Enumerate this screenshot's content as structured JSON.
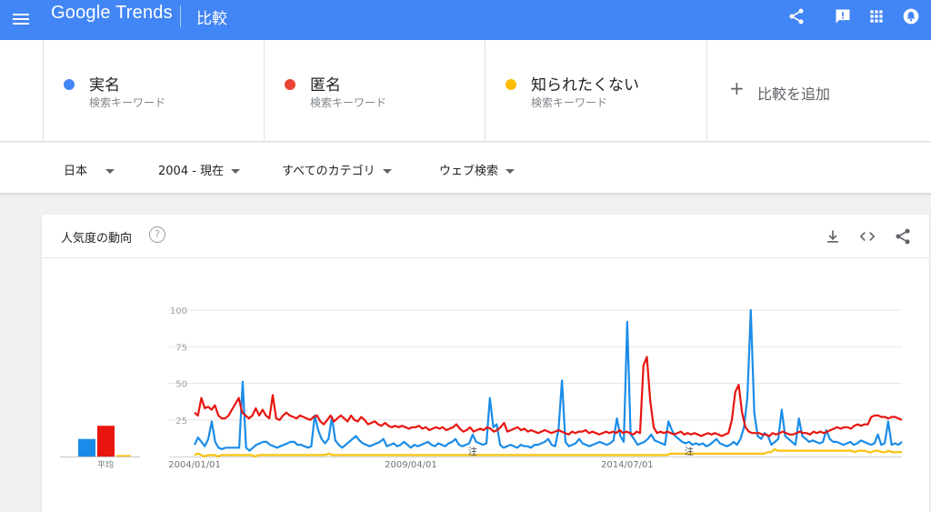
{
  "header": {
    "logo": "Google Trends",
    "page_title": "比較"
  },
  "terms": [
    {
      "name": "実名",
      "subtitle": "検索キーワード",
      "color": "#4285f4"
    },
    {
      "name": "匿名",
      "subtitle": "検索キーワード",
      "color": "#ea4335"
    },
    {
      "name": "知られたくない",
      "subtitle": "検索キーワード",
      "color": "#fbbc04"
    }
  ],
  "add_term_label": "比較を追加",
  "filters": {
    "region": "日本",
    "period": "2004 - 現在",
    "category": "すべてのカテゴリ",
    "search_type": "ウェブ検索"
  },
  "card": {
    "title": "人気度の動向",
    "help": "?"
  },
  "chart_data": {
    "type": "line",
    "x_labels": [
      "2004/01/01",
      "2009/04/01",
      "2014/07/01"
    ],
    "y_ticks": [
      100,
      75,
      50,
      25
    ],
    "ylim": [
      0,
      100
    ],
    "annotation_label": "注",
    "annotations": [
      "2010-10",
      "2016-01"
    ],
    "average": {
      "label": "平均",
      "values": [
        12,
        21,
        1
      ]
    },
    "series": [
      {
        "color": "#1a8ce8",
        "values": [
          8,
          13,
          10,
          7,
          12,
          24,
          10,
          6,
          5,
          6,
          6,
          6,
          6,
          6,
          51,
          6,
          4,
          6,
          8,
          9,
          10,
          10,
          8,
          7,
          6,
          7,
          8,
          9,
          10,
          10,
          8,
          8,
          7,
          6,
          7,
          28,
          18,
          12,
          9,
          12,
          27,
          11,
          8,
          6,
          8,
          10,
          12,
          14,
          11,
          9,
          8,
          7,
          8,
          9,
          10,
          12,
          7,
          8,
          9,
          7,
          8,
          10,
          8,
          6,
          8,
          7,
          8,
          9,
          10,
          8,
          7,
          9,
          8,
          7,
          9,
          10,
          12,
          8,
          7,
          8,
          9,
          15,
          10,
          9,
          8,
          9,
          40,
          20,
          22,
          8,
          6,
          7,
          8,
          7,
          6,
          8,
          7,
          7,
          6,
          8,
          8,
          9,
          10,
          12,
          8,
          7,
          18,
          52,
          10,
          7,
          8,
          9,
          12,
          9,
          8,
          7,
          8,
          9,
          10,
          9,
          8,
          9,
          11,
          26,
          14,
          10,
          92,
          15,
          12,
          8,
          9,
          10,
          12,
          15,
          11,
          10,
          9,
          8,
          24,
          18,
          14,
          12,
          10,
          9,
          10,
          8,
          9,
          8,
          9,
          7,
          8,
          10,
          12,
          9,
          8,
          7,
          8,
          10,
          8,
          12,
          20,
          40,
          100,
          30,
          14,
          12,
          16,
          14,
          8,
          10,
          12,
          32,
          14,
          12,
          10,
          8,
          26,
          14,
          12,
          10,
          11,
          10,
          9,
          10,
          18,
          12,
          10,
          10,
          9,
          8,
          9,
          10,
          8,
          9,
          11,
          10,
          9,
          8,
          9,
          15,
          8,
          9,
          24,
          8,
          9,
          8,
          10
        ]
      },
      {
        "color": "#e8150f",
        "values": [
          30,
          28,
          40,
          33,
          34,
          32,
          35,
          28,
          26,
          26,
          28,
          32,
          36,
          40,
          30,
          28,
          26,
          28,
          33,
          28,
          32,
          28,
          26,
          42,
          26,
          25,
          28,
          30,
          28,
          27,
          26,
          28,
          27,
          26,
          25,
          27,
          28,
          24,
          22,
          25,
          28,
          24,
          26,
          28,
          26,
          24,
          28,
          25,
          24,
          27,
          25,
          22,
          23,
          24,
          22,
          21,
          23,
          21,
          20,
          21,
          20,
          21,
          20,
          19,
          20,
          20,
          21,
          19,
          20,
          18,
          19,
          20,
          19,
          20,
          18,
          19,
          20,
          22,
          19,
          17,
          18,
          20,
          17,
          18,
          19,
          18,
          20,
          19,
          17,
          18,
          20,
          23,
          17,
          18,
          19,
          20,
          18,
          19,
          17,
          18,
          17,
          16,
          17,
          18,
          17,
          16,
          17,
          18,
          17,
          16,
          15,
          17,
          16,
          17,
          17,
          18,
          16,
          17,
          16,
          15,
          16,
          17,
          16,
          17,
          16,
          18,
          16,
          17,
          16,
          15,
          17,
          16,
          62,
          68,
          38,
          20,
          16,
          17,
          16,
          17,
          16,
          15,
          16,
          17,
          15,
          16,
          15,
          16,
          15,
          14,
          15,
          16,
          15,
          16,
          15,
          14,
          15,
          16,
          25,
          44,
          49,
          30,
          20,
          17,
          16,
          16,
          16,
          15,
          15,
          14,
          16,
          15,
          16,
          17,
          16,
          15,
          15,
          16,
          17,
          16,
          16,
          15,
          17,
          16,
          17,
          16,
          17,
          18,
          19,
          20,
          19,
          20,
          20,
          19,
          21,
          22,
          21,
          22,
          22,
          27,
          28,
          28,
          27,
          27,
          26,
          27,
          27,
          26,
          25
        ]
      },
      {
        "color": "#f9c10b",
        "values": [
          1,
          2,
          1,
          0,
          1,
          1,
          1,
          0,
          1,
          1,
          1,
          1,
          1,
          1,
          1,
          1,
          1,
          1,
          0,
          1,
          1,
          1,
          1,
          1,
          1,
          1,
          1,
          1,
          1,
          1,
          1,
          1,
          1,
          1,
          1,
          1,
          1,
          1,
          1,
          1,
          2,
          1,
          1,
          1,
          1,
          1,
          1,
          1,
          1,
          1,
          1,
          1,
          1,
          1,
          1,
          1,
          1,
          1,
          1,
          1,
          1,
          1,
          1,
          1,
          1,
          1,
          1,
          1,
          1,
          1,
          1,
          1,
          1,
          1,
          1,
          1,
          1,
          1,
          1,
          1,
          1,
          1,
          1,
          1,
          1,
          1,
          1,
          1,
          1,
          1,
          1,
          1,
          1,
          1,
          1,
          1,
          1,
          1,
          1,
          1,
          1,
          1,
          1,
          1,
          1,
          1,
          1,
          1,
          1,
          1,
          1,
          1,
          1,
          1,
          1,
          1,
          1,
          1,
          1,
          1,
          1,
          1,
          1,
          1,
          1,
          1,
          1,
          1,
          1,
          1,
          1,
          1,
          1,
          1,
          1,
          1,
          1,
          1,
          1,
          1,
          1,
          1,
          2,
          2,
          2,
          2,
          2,
          2,
          2,
          2,
          2,
          2,
          2,
          2,
          2,
          2,
          2,
          2,
          2,
          2,
          2,
          2,
          2,
          2,
          2,
          2,
          2,
          2,
          2,
          2,
          2,
          3,
          3,
          5,
          4,
          4,
          4,
          4,
          4,
          4,
          4,
          4,
          4,
          4,
          4,
          4,
          4,
          4,
          4,
          4,
          4,
          4,
          4,
          4,
          4,
          4,
          4,
          3,
          4,
          4,
          4,
          3,
          3,
          4,
          4,
          3,
          3,
          4,
          3,
          3,
          3,
          3
        ]
      }
    ]
  }
}
